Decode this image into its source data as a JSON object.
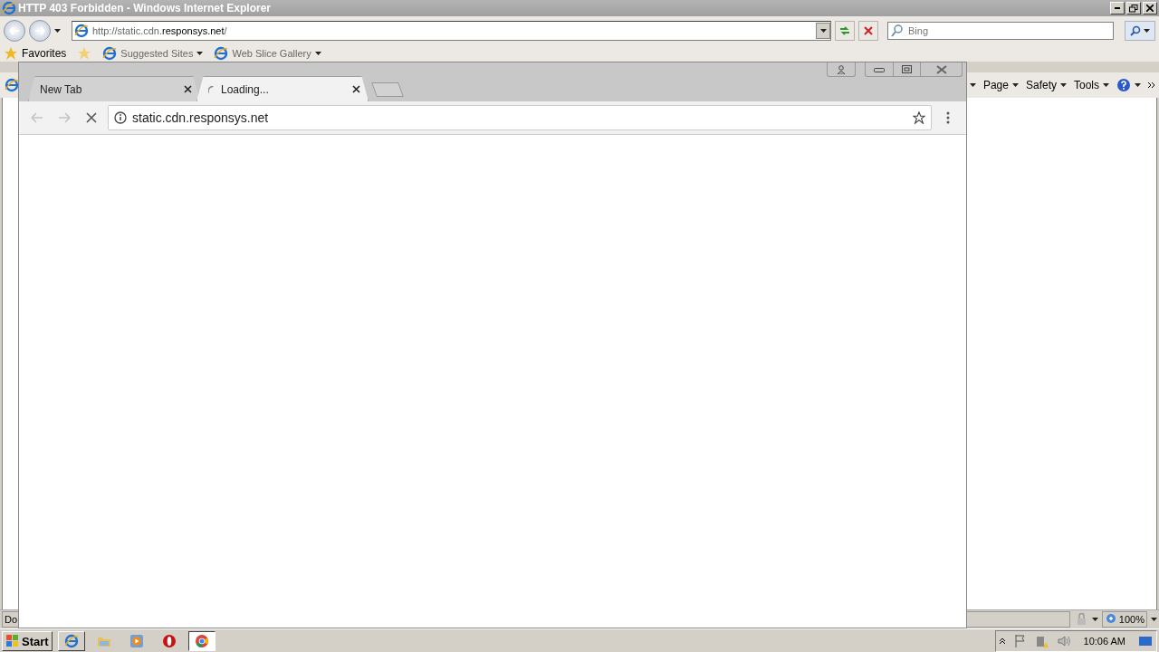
{
  "ie": {
    "title": "HTTP 403 Forbidden - Windows Internet Explorer",
    "address_prefix": "http://static.cdn.",
    "address_domain": "responsys.net",
    "address_suffix": "/",
    "search_placeholder": "Bing",
    "favorites_label": "Favorites",
    "favorites_items": [
      "Suggested Sites",
      "Web Slice Gallery"
    ],
    "commands": [
      "Page",
      "Safety",
      "Tools"
    ],
    "status_text": "Do",
    "zoom": "100%"
  },
  "chrome": {
    "tabs": [
      {
        "title": "New Tab",
        "selected": false,
        "loading": false
      },
      {
        "title": "Loading...",
        "selected": true,
        "loading": true
      }
    ],
    "url": "static.cdn.responsys.net"
  },
  "taskbar": {
    "start": "Start",
    "apps": [
      {
        "kind": "ie",
        "selected": false
      },
      {
        "kind": "folder",
        "selected": false
      },
      {
        "kind": "media",
        "selected": false
      },
      {
        "kind": "opera",
        "selected": false
      },
      {
        "kind": "chrome",
        "selected": true
      }
    ],
    "clock": "10:06 AM"
  }
}
